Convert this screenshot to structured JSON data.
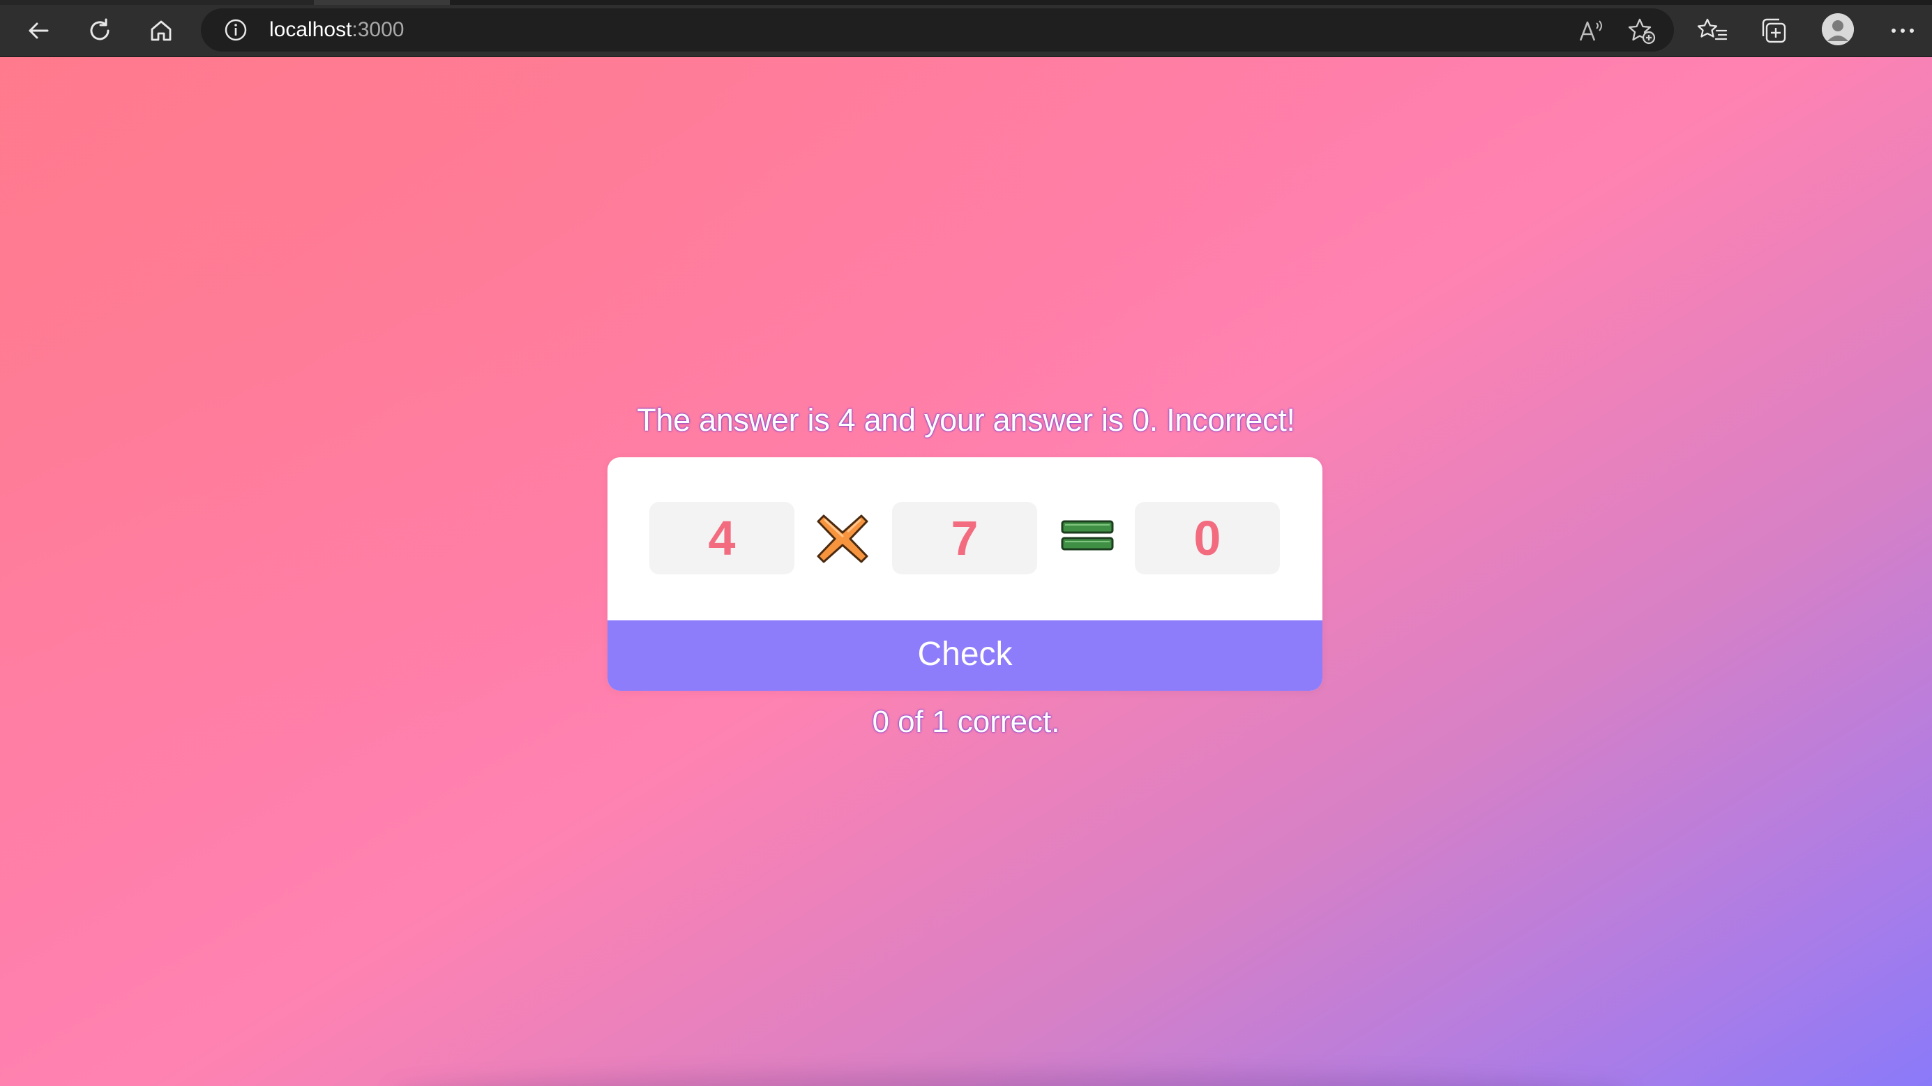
{
  "browser": {
    "url_host": "localhost",
    "url_port": ":3000",
    "icons": {
      "back": "arrow-left-icon",
      "refresh": "refresh-icon",
      "home": "home-icon",
      "site_info": "info-icon",
      "read_aloud": "read-aloud-icon",
      "add_favorite": "star-add-icon",
      "favorites": "favorites-list-icon",
      "collections": "collections-icon",
      "profile": "profile-avatar-icon",
      "more": "more-dots-icon"
    }
  },
  "quiz": {
    "message": "The answer is 4 and your answer is 0. Incorrect!",
    "operand_a": "4",
    "operator_icon": "multiply-x-icon",
    "operand_b": "7",
    "equals_icon": "equals-icon",
    "answer": "0",
    "check_label": "Check",
    "score_text": "0 of 1 correct."
  },
  "colors": {
    "number_text": "#f36b7f",
    "button_bg": "#8e7dfb",
    "card_bg": "#ffffff",
    "box_bg": "#f3f3f3",
    "gradient_start": "#ff7b8c",
    "gradient_end": "#8a7af9",
    "operator_fill": "#f7953f",
    "equals_fill": "#3f8f45"
  }
}
